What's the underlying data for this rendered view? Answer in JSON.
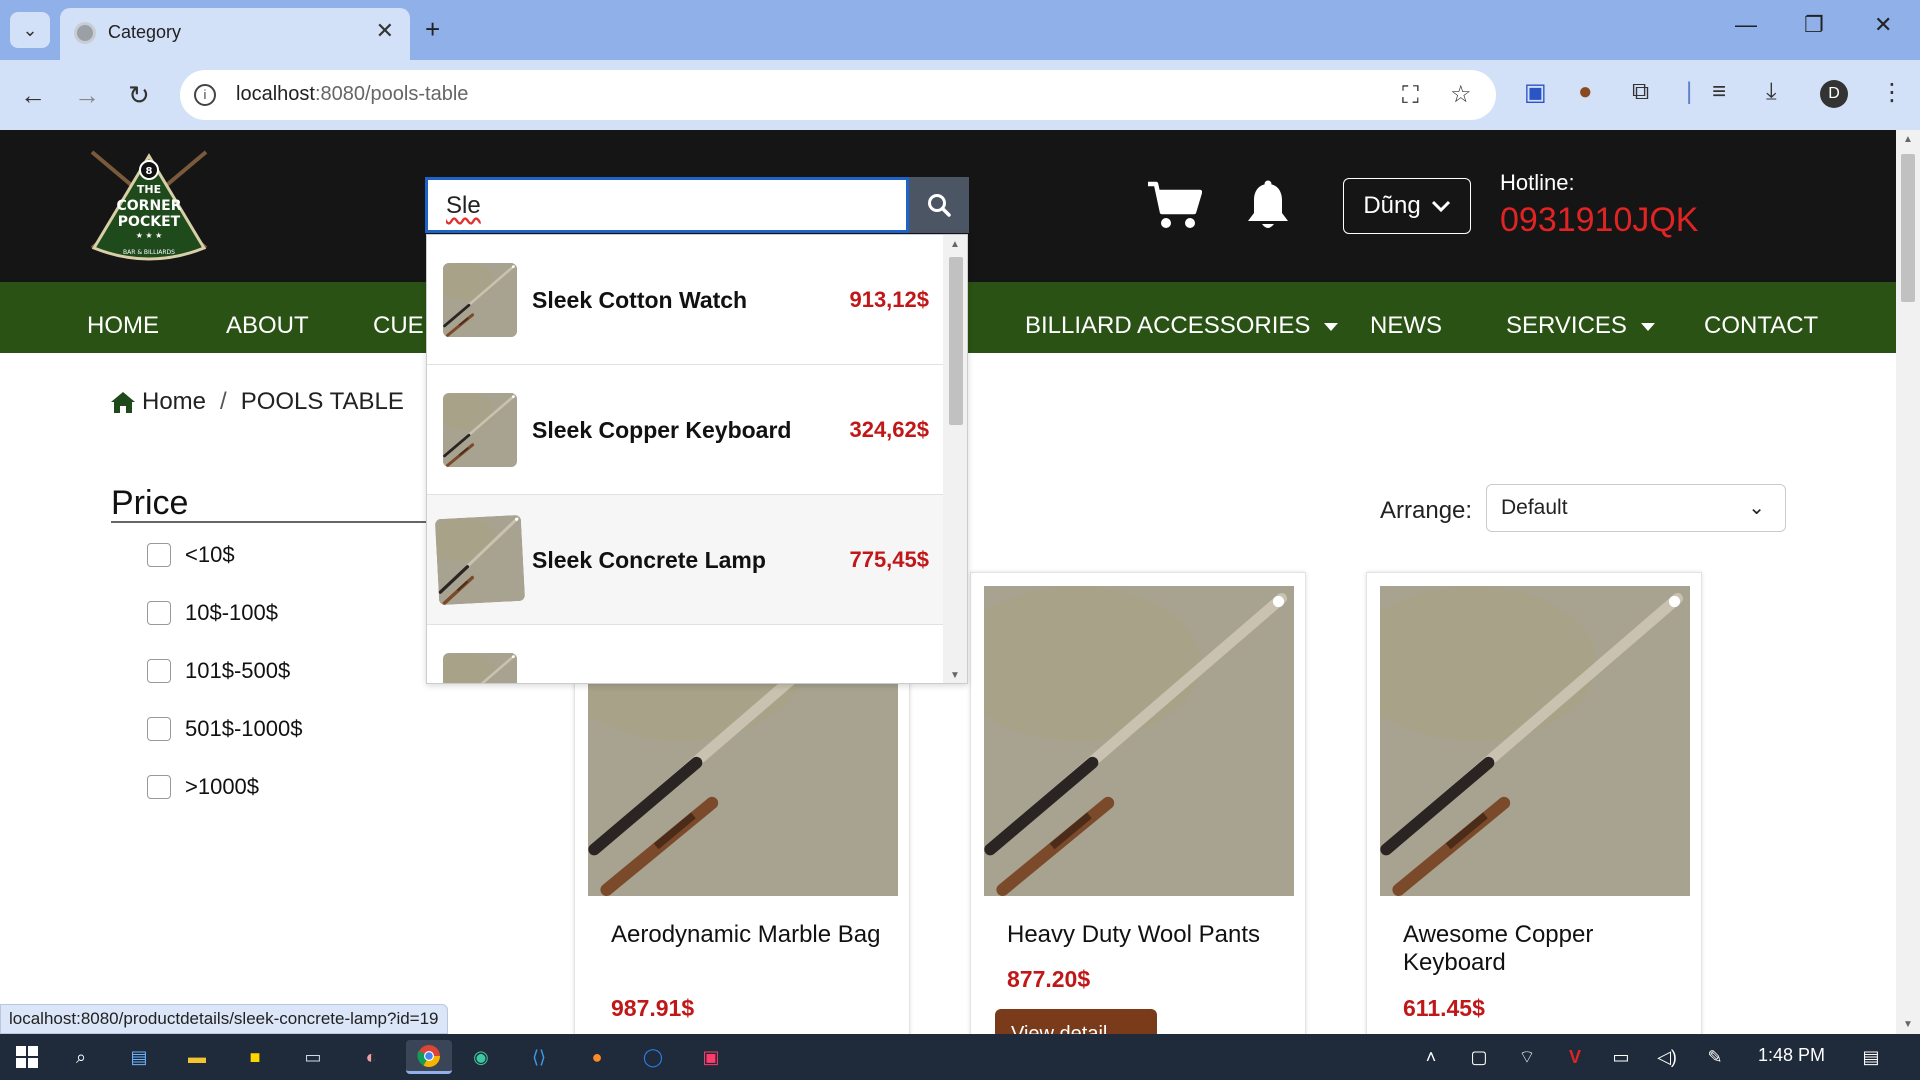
{
  "browser": {
    "tab_title": "Category",
    "url_host": "localhost",
    "url_rest": ":8080/pools-table",
    "profile_initial": "D"
  },
  "header": {
    "search_value": "Sle",
    "user_name": "Dũng",
    "hotline_label": "Hotline:",
    "hotline_number": "0931910JQK"
  },
  "nav": {
    "items": [
      "HOME",
      "ABOUT",
      "CUE S",
      "BILLIARD ACCESSORIES",
      "NEWS",
      "SERVICES",
      "CONTACT"
    ]
  },
  "breadcrumb": {
    "home": "Home",
    "sep": "/",
    "current": "POOLS TABLE"
  },
  "filter": {
    "title": "Price",
    "options": [
      "<10$",
      "10$-100$",
      "101$-500$",
      "501$-1000$",
      ">1000$"
    ]
  },
  "sort": {
    "label": "Arrange:",
    "value": "Default"
  },
  "suggestions": [
    {
      "name": "Sleek Cotton Watch",
      "price": "913,12$"
    },
    {
      "name": "Sleek Copper Keyboard",
      "price": "324,62$"
    },
    {
      "name": "Sleek Concrete Lamp",
      "price": "775,45$"
    }
  ],
  "products": [
    {
      "name": "Aerodynamic Marble Bag",
      "price": "987.91$"
    },
    {
      "name": "Heavy Duty Wool Pants",
      "price": "877.20$",
      "button": "View detail"
    },
    {
      "name": "Awesome Copper Keyboard",
      "price": "611.45$"
    }
  ],
  "status_bar": {
    "url": "localhost:8080/productdetails/sleek-concrete-lamp?id=19"
  },
  "taskbar": {
    "time": "1:48 PM"
  },
  "colors": {
    "header_bg": "#151515",
    "nav_bg": "#2a5214",
    "price_red": "#c01818",
    "hotline_red": "#e02424",
    "browser_frame": "#8fb0e9"
  }
}
